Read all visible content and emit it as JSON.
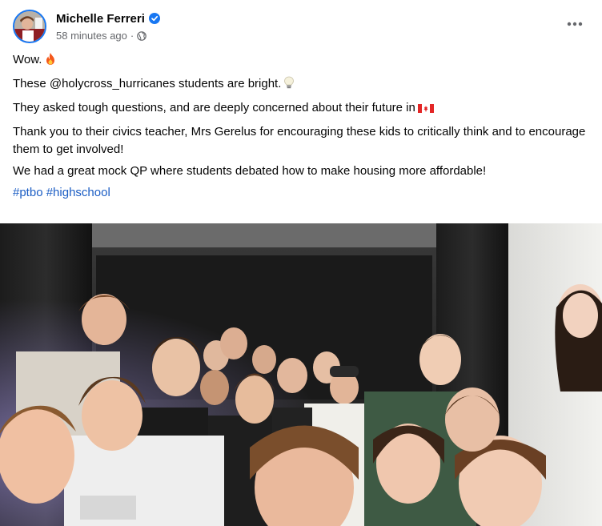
{
  "post": {
    "author": "Michelle Ferreri",
    "timestamp": "58 minutes ago",
    "separator": "·",
    "audience_icon": "globe-icon",
    "verified_icon": "verified-badge-icon",
    "more_icon": "more-options-icon",
    "paragraphs": [
      "Wow.",
      "These @holycross_hurricanes students are bright.",
      "They asked tough questions, and are deeply concerned about their future in",
      "Thank you to their civics teacher, Mrs Gerelus for encouraging these kids to critically think and to encourage them to get involved!",
      "We had a great mock QP where students debated how to make housing more affordable!"
    ],
    "emojis": [
      "fire-emoji",
      "light-bulb-emoji",
      "canada-flag-emoji"
    ],
    "hashtags": [
      "#ptbo",
      "#highschool"
    ]
  },
  "colors": {
    "verified": "#1877f2",
    "hashtag": "#1b5dc4",
    "secondary_text": "#65676b"
  }
}
